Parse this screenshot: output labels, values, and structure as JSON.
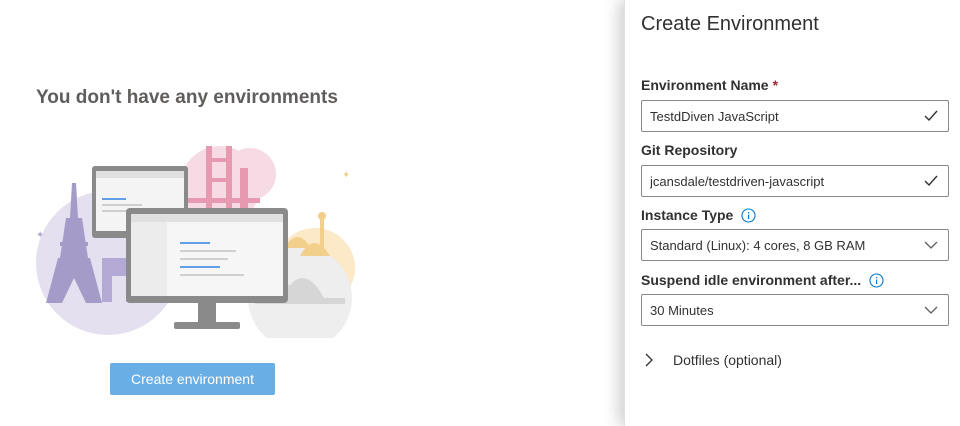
{
  "empty_state": {
    "title": "You don't have any environments",
    "create_button_label": "Create environment"
  },
  "panel": {
    "title": "Create Environment",
    "fields": {
      "environment_name": {
        "label": "Environment Name",
        "required_mark": "*",
        "value": "TestdDiven JavaScript"
      },
      "git_repository": {
        "label": "Git Repository",
        "value": "jcansdale/testdriven-javascript"
      },
      "instance_type": {
        "label": "Instance Type",
        "value": "Standard (Linux): 4 cores, 8 GB RAM"
      },
      "suspend_idle": {
        "label": "Suspend idle environment after...",
        "value": "30 Minutes"
      }
    },
    "dotfiles_label": "Dotfiles (optional)"
  },
  "colors": {
    "primary_button": "#6aaee6",
    "info_icon": "#0078d4",
    "required": "#a4262c",
    "field_border": "#8a8886"
  },
  "icons": {
    "valid": "checkmark-icon",
    "dropdown": "chevron-down-icon",
    "info": "info-icon",
    "expander": "chevron-right-icon"
  }
}
